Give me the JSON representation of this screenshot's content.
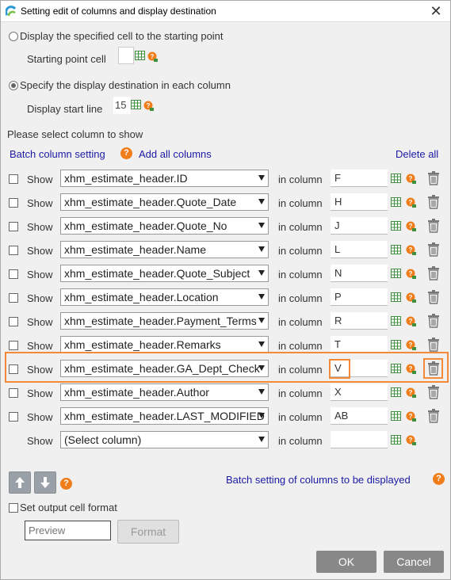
{
  "title": "Setting edit of columns and display destination",
  "option1": {
    "label": "Display the specified cell to the starting point",
    "starting_point_label": "Starting point cell",
    "starting_point_value": ""
  },
  "option2": {
    "label": "Specify the display destination in each column",
    "display_start_label": "Display start line",
    "display_start_value": "15"
  },
  "section_label": "Please select column to show",
  "batch_column_setting": "Batch column setting",
  "add_all_columns": "Add all columns",
  "delete_all": "Delete all",
  "show_label": "Show",
  "in_column_label": "in column",
  "rows": [
    {
      "column": "xhm_estimate_header.ID",
      "dest": "F"
    },
    {
      "column": "xhm_estimate_header.Quote_Date",
      "dest": "H"
    },
    {
      "column": "xhm_estimate_header.Quote_No",
      "dest": "J"
    },
    {
      "column": "xhm_estimate_header.Name",
      "dest": "L"
    },
    {
      "column": "xhm_estimate_header.Quote_Subject",
      "dest": "N"
    },
    {
      "column": "xhm_estimate_header.Location",
      "dest": "P"
    },
    {
      "column": "xhm_estimate_header.Payment_Terms",
      "dest": "R"
    },
    {
      "column": "xhm_estimate_header.Remarks",
      "dest": "T"
    },
    {
      "column": "xhm_estimate_header.GA_Dept_Check",
      "dest": "V"
    },
    {
      "column": "xhm_estimate_header.Author",
      "dest": "X"
    },
    {
      "column": "xhm_estimate_header.LAST_MODIFIED",
      "dest": "AB"
    },
    {
      "column": "(Select column)",
      "dest": ""
    }
  ],
  "batch_setting_displayed": "Batch setting of columns to be displayed",
  "set_output_format": "Set output cell format",
  "preview_placeholder": "Preview",
  "format_button": "Format",
  "ok_button": "OK",
  "cancel_button": "Cancel",
  "colors": {
    "accent_orange": "#f28a3a",
    "link_blue": "#1a1aa6",
    "button_gray": "#888888"
  }
}
